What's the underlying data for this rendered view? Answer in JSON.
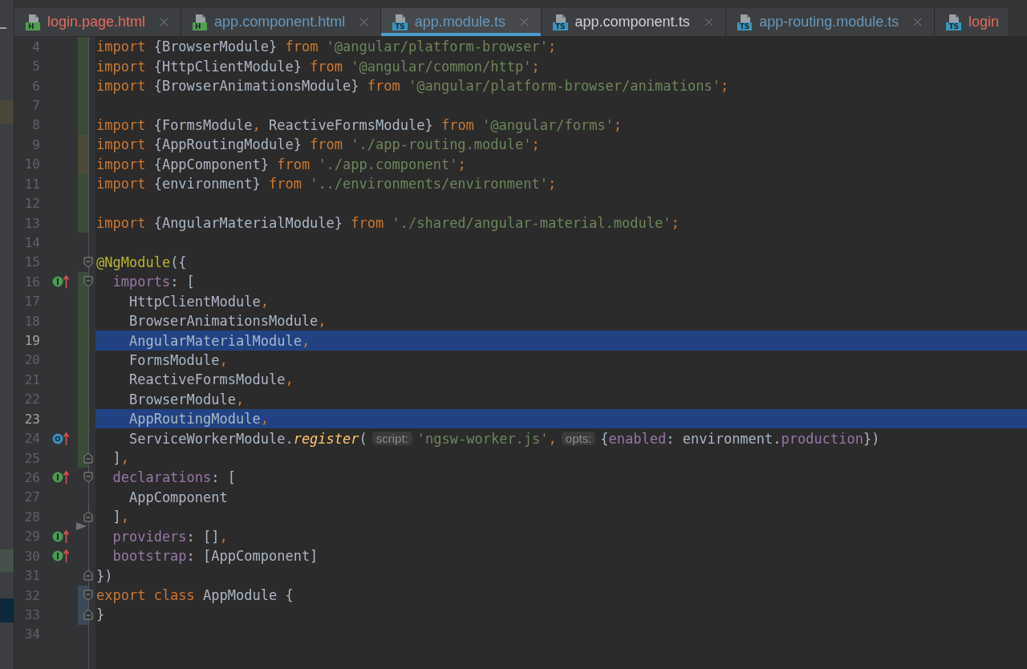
{
  "tabs": [
    {
      "label": "login.page.html",
      "kind": "html",
      "badge": "H",
      "color": "#e06c5f",
      "selected": false,
      "closable": true
    },
    {
      "label": "app.component.html",
      "kind": "html",
      "badge": "H",
      "color": "#6897bb",
      "selected": false,
      "closable": true
    },
    {
      "label": "app.module.ts",
      "kind": "ts",
      "badge": "TS",
      "color": "#6897bb",
      "selected": true,
      "closable": true
    },
    {
      "label": "app.component.ts",
      "kind": "ts",
      "badge": "TS",
      "color": "#d0d0d0",
      "selected": false,
      "closable": true
    },
    {
      "label": "app-routing.module.ts",
      "kind": "ts",
      "badge": "TS",
      "color": "#6897bb",
      "selected": false,
      "closable": true
    },
    {
      "label": "login",
      "kind": "ts",
      "badge": "TS",
      "color": "#e06c5f",
      "selected": false,
      "closable": false
    }
  ],
  "lines": [
    {
      "number": "4",
      "selected": false,
      "color": "#384c38",
      "tokens": [
        {
          "kind": "keyword",
          "text": "import "
        },
        {
          "kind": "plain",
          "text": "{BrowserModule} "
        },
        {
          "kind": "keyword",
          "text": "from "
        },
        {
          "kind": "string",
          "text": "'@angular/platform-browser'"
        },
        {
          "kind": "punct",
          "text": ";"
        }
      ]
    },
    {
      "number": "5",
      "selected": false,
      "color": "#384c38",
      "tokens": [
        {
          "kind": "keyword",
          "text": "import "
        },
        {
          "kind": "plain",
          "text": "{HttpClientModule} "
        },
        {
          "kind": "keyword",
          "text": "from "
        },
        {
          "kind": "string",
          "text": "'@angular/common/http'"
        },
        {
          "kind": "punct",
          "text": ";"
        }
      ]
    },
    {
      "number": "6",
      "selected": false,
      "color": "#384c38",
      "tokens": [
        {
          "kind": "keyword",
          "text": "import "
        },
        {
          "kind": "plain",
          "text": "{BrowserAnimationsModule} "
        },
        {
          "kind": "keyword",
          "text": "from "
        },
        {
          "kind": "string",
          "text": "'@angular/platform-browser/animations'"
        },
        {
          "kind": "punct",
          "text": ";"
        }
      ]
    },
    {
      "number": "7",
      "selected": false,
      "color": "#384c38"
    },
    {
      "number": "8",
      "selected": false,
      "color": "#384c38",
      "tokens": [
        {
          "kind": "keyword",
          "text": "import "
        },
        {
          "kind": "plain",
          "text": "{FormsModule"
        },
        {
          "kind": "punct",
          "text": ","
        },
        {
          "kind": "plain",
          "text": " ReactiveFormsModule} "
        },
        {
          "kind": "keyword",
          "text": "from "
        },
        {
          "kind": "string",
          "text": "'@angular/forms'"
        },
        {
          "kind": "punct",
          "text": ";"
        }
      ]
    },
    {
      "number": "9",
      "selected": false,
      "color": "#4d4a3a",
      "tokens": [
        {
          "kind": "keyword",
          "text": "import "
        },
        {
          "kind": "plain",
          "text": "{AppRoutingModule} "
        },
        {
          "kind": "keyword",
          "text": "from "
        },
        {
          "kind": "string",
          "text": "'./app-routing.module'"
        },
        {
          "kind": "punct",
          "text": ";"
        }
      ]
    },
    {
      "number": "10",
      "selected": false,
      "color": "#4d4a3a",
      "tokens": [
        {
          "kind": "keyword",
          "text": "import "
        },
        {
          "kind": "plain",
          "text": "{AppComponent} "
        },
        {
          "kind": "keyword",
          "text": "from "
        },
        {
          "kind": "string",
          "text": "'./app.component'"
        },
        {
          "kind": "punct",
          "text": ";"
        }
      ]
    },
    {
      "number": "11",
      "selected": false,
      "color": "#384c38",
      "tokens": [
        {
          "kind": "keyword",
          "text": "import "
        },
        {
          "kind": "plain",
          "text": "{environment} "
        },
        {
          "kind": "keyword",
          "text": "from "
        },
        {
          "kind": "string",
          "text": "'../environments/environment'"
        },
        {
          "kind": "punct",
          "text": ";"
        }
      ]
    },
    {
      "number": "12",
      "selected": false,
      "color": "#384c38"
    },
    {
      "number": "13",
      "selected": false,
      "color": "#384c38",
      "tokens": [
        {
          "kind": "keyword",
          "text": "import "
        },
        {
          "kind": "plain",
          "text": "{AngularMaterialModule} "
        },
        {
          "kind": "keyword",
          "text": "from "
        },
        {
          "kind": "string",
          "text": "'./shared/angular-material.module'"
        },
        {
          "kind": "punct",
          "text": ";"
        }
      ]
    },
    {
      "number": "14",
      "selected": false
    },
    {
      "number": "15",
      "selected": false,
      "fold_start": true,
      "tokens": [
        {
          "kind": "decorator",
          "text": "@NgModule"
        },
        {
          "kind": "plain",
          "text": "({"
        }
      ]
    },
    {
      "number": "16",
      "selected": false,
      "color": "#384c38",
      "implements": true,
      "fold_start": true,
      "tokens": [
        {
          "kind": "property",
          "text": "  imports"
        },
        {
          "kind": "plain",
          "text": ": ["
        }
      ]
    },
    {
      "number": "17",
      "selected": false,
      "color": "#384c38",
      "tokens": [
        {
          "kind": "plain",
          "text": "    HttpClientModule"
        },
        {
          "kind": "punct",
          "text": ","
        }
      ]
    },
    {
      "number": "18",
      "selected": false,
      "color": "#384c38",
      "tokens": [
        {
          "kind": "plain",
          "text": "    BrowserAnimationsModule"
        },
        {
          "kind": "punct",
          "text": ","
        }
      ]
    },
    {
      "number": "19",
      "selected": true,
      "color": "#384c38",
      "tokens": [
        {
          "kind": "plain",
          "text": "    AngularMaterialModule"
        },
        {
          "kind": "punct",
          "text": ","
        }
      ]
    },
    {
      "number": "20",
      "selected": false,
      "color": "#384c38",
      "tokens": [
        {
          "kind": "plain",
          "text": "    FormsModule"
        },
        {
          "kind": "punct",
          "text": ","
        }
      ]
    },
    {
      "number": "21",
      "selected": false,
      "color": "#384c38",
      "tokens": [
        {
          "kind": "plain",
          "text": "    ReactiveFormsModule"
        },
        {
          "kind": "punct",
          "text": ","
        }
      ]
    },
    {
      "number": "22",
      "selected": false,
      "color": "#384c38",
      "tokens": [
        {
          "kind": "plain",
          "text": "    BrowserModule"
        },
        {
          "kind": "punct",
          "text": ","
        }
      ]
    },
    {
      "number": "23",
      "selected": true,
      "color": "#384c38",
      "tokens": [
        {
          "kind": "plain",
          "text": "    AppRoutingModule"
        },
        {
          "kind": "punct",
          "text": ","
        }
      ]
    },
    {
      "number": "24",
      "selected": false,
      "color": "#384c38",
      "overrides": true,
      "tokens": [
        {
          "kind": "plain",
          "text": "    ServiceWorkerModule."
        },
        {
          "kind": "method",
          "text": "register"
        },
        {
          "kind": "plain",
          "text": "("
        },
        {
          "kind": "hint",
          "text": "script:"
        },
        {
          "kind": "string",
          "text": "'ngsw-worker.js'"
        },
        {
          "kind": "punct",
          "text": ","
        },
        {
          "kind": "hint",
          "text": "opts:"
        },
        {
          "kind": "plain",
          "text": "{"
        },
        {
          "kind": "property",
          "text": "enabled"
        },
        {
          "kind": "plain",
          "text": ": environment."
        },
        {
          "kind": "property",
          "text": "production"
        },
        {
          "kind": "plain",
          "text": "})"
        }
      ]
    },
    {
      "number": "25",
      "selected": false,
      "color": "#384c38",
      "fold_end": true,
      "tokens": [
        {
          "kind": "plain",
          "text": "  ]"
        },
        {
          "kind": "punct",
          "text": ","
        }
      ]
    },
    {
      "number": "26",
      "selected": false,
      "implements": true,
      "fold_start": true,
      "tokens": [
        {
          "kind": "property",
          "text": "  declarations"
        },
        {
          "kind": "plain",
          "text": ": ["
        }
      ]
    },
    {
      "number": "27",
      "selected": false,
      "tokens": [
        {
          "kind": "plain",
          "text": "    AppComponent"
        }
      ]
    },
    {
      "number": "28",
      "selected": false,
      "fold_end": true,
      "tokens": [
        {
          "kind": "plain",
          "text": "  ]"
        },
        {
          "kind": "punct",
          "text": ","
        }
      ]
    },
    {
      "number": "29",
      "selected": false,
      "implements": true,
      "pointer": true,
      "tokens": [
        {
          "kind": "property",
          "text": "  providers"
        },
        {
          "kind": "plain",
          "text": ": []"
        },
        {
          "kind": "punct",
          "text": ","
        }
      ]
    },
    {
      "number": "30",
      "selected": false,
      "implements": true,
      "tokens": [
        {
          "kind": "property",
          "text": "  bootstrap"
        },
        {
          "kind": "plain",
          "text": ": [AppComponent]"
        }
      ]
    },
    {
      "number": "31",
      "selected": false,
      "fold_end": true,
      "tokens": [
        {
          "kind": "plain",
          "text": "})"
        }
      ]
    },
    {
      "number": "32",
      "selected": false,
      "color": "#3a4a58",
      "fold_start": true,
      "tokens": [
        {
          "kind": "keyword",
          "text": "export class "
        },
        {
          "kind": "plain",
          "text": "AppModule {"
        }
      ]
    },
    {
      "number": "33",
      "selected": false,
      "color": "#3a4a58",
      "fold_end": true,
      "tokens": [
        {
          "kind": "plain",
          "text": "}"
        }
      ]
    },
    {
      "number": "34",
      "selected": false
    }
  ]
}
